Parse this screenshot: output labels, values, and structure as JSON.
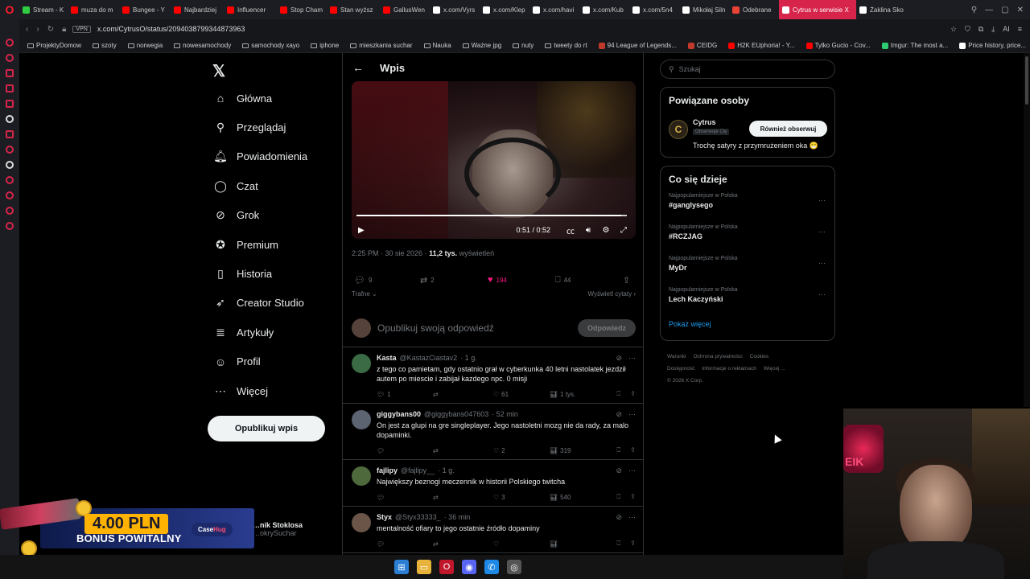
{
  "browser": {
    "tabs": [
      {
        "label": "Stream - K",
        "color": "#2ecc40"
      },
      {
        "label": "muza do m",
        "color": "#ff0000"
      },
      {
        "label": "Bungee - Y",
        "color": "#ff0000"
      },
      {
        "label": "Najbardziej",
        "color": "#ff0000"
      },
      {
        "label": "Influencer",
        "color": "#ff0000"
      },
      {
        "label": "Stop Cham",
        "color": "#ff0000"
      },
      {
        "label": "Stan wyższ",
        "color": "#ff0000"
      },
      {
        "label": "GallusWen",
        "color": "#ff0000"
      },
      {
        "label": "x.com/Vyrs",
        "color": "#ffffff"
      },
      {
        "label": "x.com/Klep",
        "color": "#ffffff"
      },
      {
        "label": "x.com/havi",
        "color": "#ffffff"
      },
      {
        "label": "x.com/Kub",
        "color": "#ffffff"
      },
      {
        "label": "x.com/5n4",
        "color": "#ffffff"
      },
      {
        "label": "Mikołaj Siln",
        "color": "#ffffff"
      },
      {
        "label": "Odebrane",
        "color": "#ea4335"
      },
      {
        "label": "Cytrus w serwisie X",
        "color": "#ffffff",
        "active": true
      },
      {
        "label": "Żaklina Sko",
        "color": "#ffffff"
      }
    ],
    "vpn_label": "VPN",
    "url": "x.com/CytrusO/status/2094038799344873963",
    "bookmarks": [
      {
        "label": "ProjektyDomow",
        "type": "folder"
      },
      {
        "label": "szoty",
        "type": "folder"
      },
      {
        "label": "norwegia",
        "type": "folder"
      },
      {
        "label": "nowesamochody",
        "type": "folder"
      },
      {
        "label": "samochody xayo",
        "type": "folder"
      },
      {
        "label": "iphone",
        "type": "folder"
      },
      {
        "label": "mieszkania suchar",
        "type": "folder"
      },
      {
        "label": "Nauka",
        "type": "folder"
      },
      {
        "label": "Ważne jpg",
        "type": "folder"
      },
      {
        "label": "nuty",
        "type": "folder"
      },
      {
        "label": "tweety do rt",
        "type": "folder"
      },
      {
        "label": "94 League of Legends...",
        "type": "site",
        "color": "#c0392b"
      },
      {
        "label": "CEIDG",
        "type": "site",
        "color": "#c0392b"
      },
      {
        "label": "H2K EUphoria! - Y...",
        "type": "site",
        "color": "#ff0000"
      },
      {
        "label": "Tylko Gucio - Cov...",
        "type": "site",
        "color": "#ff0000"
      },
      {
        "label": "Imgur: The most a...",
        "type": "site",
        "color": "#2ecc71"
      },
      {
        "label": "Price history, price...",
        "type": "site",
        "color": "#ffffff"
      }
    ]
  },
  "nav": {
    "items": [
      {
        "label": "Główna",
        "icon": "⌂",
        "name": "home"
      },
      {
        "label": "Przeglądaj",
        "icon": "⚲",
        "name": "explore"
      },
      {
        "label": "Powiadomienia",
        "icon": "🔔︎",
        "name": "notifications"
      },
      {
        "label": "Czat",
        "icon": "◯",
        "name": "chat"
      },
      {
        "label": "Grok",
        "icon": "⊘",
        "name": "grok"
      },
      {
        "label": "Premium",
        "icon": "✪",
        "name": "premium"
      },
      {
        "label": "Historia",
        "icon": "▯",
        "name": "bookmarks"
      },
      {
        "label": "Creator Studio",
        "icon": "➶",
        "name": "creator-studio"
      },
      {
        "label": "Artykuły",
        "icon": "≣",
        "name": "articles"
      },
      {
        "label": "Profil",
        "icon": "☺",
        "name": "profile"
      },
      {
        "label": "Więcej",
        "icon": "⋯",
        "name": "more"
      }
    ],
    "post_button": "Opublikuj wpis"
  },
  "account": {
    "name": "…nik Stoklosa",
    "handle": "…okrySuchar"
  },
  "promo": {
    "amount": "4.00 PLN",
    "bonus": "BONUS POWITALNY",
    "brand_a": "Case",
    "brand_b": "Hug"
  },
  "post": {
    "header": "Wpis",
    "video_time": "0:51 / 0:52",
    "progress": 0.98,
    "time": "2:25 PM · 30 sie 2026 · ",
    "views": "11,2 tys.",
    "views_label": " wyświetleń",
    "replies": "9",
    "reposts": "2",
    "likes": "194",
    "bookmarks": "44",
    "sort_label": "Trafne ⌄",
    "quotes_label": "Wyświetl cytaty ›",
    "reply_placeholder": "Opublikuj swoją odpowiedź",
    "reply_button": "Odpowiedz"
  },
  "replies": [
    {
      "name": "Kasta",
      "handle": "@KastazCiastav2",
      "time": "· 1 g.",
      "text": "z tego co pamietam, gdy ostatnio grał w cyberkunka 40 letni nastolatek jezdził autem po miescie i zabijał kazdego npc. 0 misji",
      "replies": "1",
      "reposts": "",
      "likes": "61",
      "views": "1 tys.",
      "avatar": "#3a6b45"
    },
    {
      "name": "giggybans00",
      "handle": "@giggybans047603",
      "time": "· 52 min",
      "text": "On jest za glupi na gre singleplayer. Jego nastoletni mozg nie da rady, za malo dopaminki.",
      "replies": "",
      "reposts": "",
      "likes": "2",
      "views": "319",
      "avatar": "#5b6470"
    },
    {
      "name": "fajlipy",
      "handle": "@fajlipy__",
      "time": "· 1 g.",
      "text": "Największy beznogi meczennik w historii Polskiego twitcha",
      "replies": "",
      "reposts": "",
      "likes": "3",
      "views": "540",
      "avatar": "#4e6a3c"
    },
    {
      "name": "Styx",
      "handle": "@Styx33333_",
      "time": "· 36 min",
      "text": "mentalność ofiary to jego ostatnie źródło dopaminy",
      "replies": "",
      "reposts": "",
      "likes": "",
      "views": "",
      "avatar": "#6a5548"
    }
  ],
  "right": {
    "search_placeholder": "Szukaj",
    "related_title": "Powiązane osoby",
    "person": {
      "name": "Cytrus",
      "badge": "Obserwuje Cię",
      "button": "Również obserwuj",
      "bio": "Trochę satyry z przymrużeniem oka 😁"
    },
    "trends_title": "Co się dzieje",
    "trends": [
      {
        "category": "Najpopularniejsze w Polska",
        "name": "#ganglysego"
      },
      {
        "category": "Najpopularniejsze w Polska",
        "name": "#RCZJAG"
      },
      {
        "category": "Najpopularniejsze w Polska",
        "name": "MyDr"
      },
      {
        "category": "Najpopularniejsze w Polska",
        "name": "Lech Kaczyński"
      }
    ],
    "show_more": "Pokaż więcej",
    "footer": [
      "Warunki",
      "Ochrona prywatności",
      "Cookies",
      "Dostępność",
      "Informacje o reklamach",
      "Więcej ...",
      "© 2026 X Corp."
    ]
  },
  "webcam": {
    "neon_text": "EIK"
  },
  "colors": {
    "accent": "#1d9bf0",
    "like": "#f91880",
    "opera": "#ff1b2d"
  }
}
